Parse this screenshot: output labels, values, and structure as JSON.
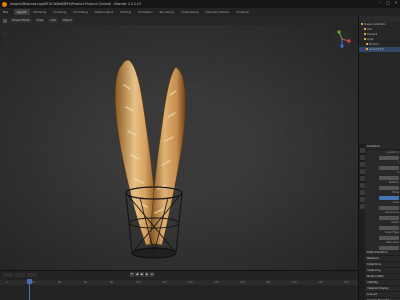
{
  "window": {
    "title": "/bagrial/Beacraqs.bg/NF.013e8a6/BlFb/Product-Product (Linked) - Blender 4.3.2.13"
  },
  "menubar": {
    "items": [
      "File"
    ],
    "workspace_tabs": [
      "Layout",
      "Modeling",
      "Sculpting",
      "UV Editing",
      "Texture Paint",
      "Shading",
      "Animation",
      "Rendering",
      "Compositing",
      "Geometry Nodes",
      "Scripting"
    ]
  },
  "viewport_header": {
    "mode": "Object Mode",
    "select_label": "Select Box",
    "view": "View",
    "add": "Add",
    "object": "Object"
  },
  "outliner": {
    "title": "Scene Collection",
    "rows": [
      "Scene Collection",
      "Coll",
      "Camera",
      "Light",
      "Product",
      "product_FR"
    ]
  },
  "properties": {
    "sections": [
      "Transform",
      "Delta Transform",
      "Relations",
      "Collections",
      "Instancing",
      "Motion Paths",
      "Visibility",
      "Viewport Display",
      "Line Art",
      "Custom Properties"
    ],
    "fields": [
      "Location X",
      "Y",
      "Z",
      "Rotation",
      "Mode",
      "Scale",
      "Dimensions",
      "Parent",
      "Parent Type",
      "Pass Index"
    ]
  },
  "timeline": {
    "ruler_marks": [
      "0",
      "20",
      "40",
      "60",
      "80",
      "100",
      "120",
      "140",
      "160",
      "180",
      "200",
      "220",
      "240",
      "260"
    ],
    "current_frame": "1"
  },
  "colors": {
    "accent": "#e87d0d",
    "selection": "#4772b3",
    "viewport_bg": "#393939"
  },
  "icons": [
    "blender-logo-icon",
    "minimize-icon",
    "maximize-icon",
    "close-icon",
    "navigation-gizmo-icon",
    "play-icon",
    "skip-start-icon",
    "skip-end-icon",
    "step-back-icon",
    "step-forward-icon"
  ]
}
